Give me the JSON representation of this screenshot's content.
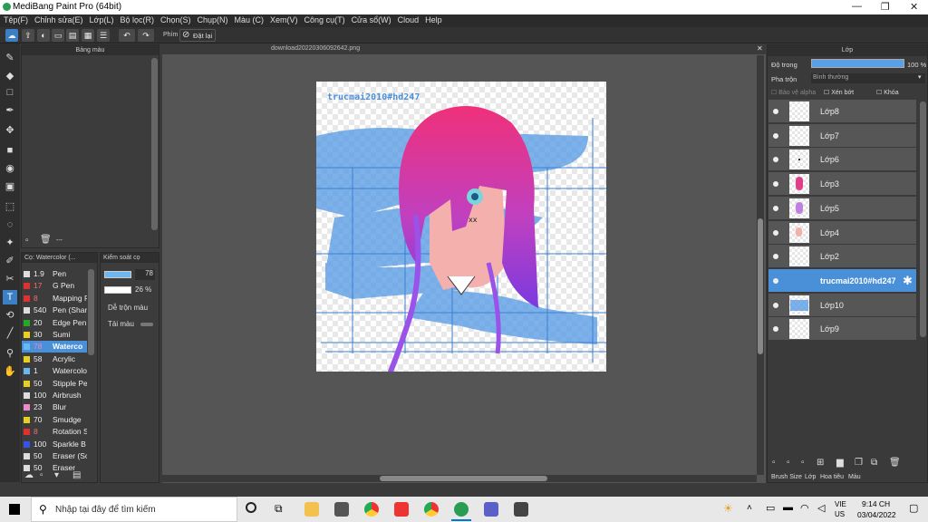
{
  "window": {
    "title": "MediBang Paint Pro (64bit)"
  },
  "menu": [
    "Tệp(F)",
    "Chỉnh sửa(E)",
    "Lớp(L)",
    "Bộ lọc(R)",
    "Chọn(S)",
    "Chụp(N)",
    "Màu (C)",
    "Xem(V)",
    "Công cụ(T)",
    "Cửa sổ(W)",
    "Cloud",
    "Help"
  ],
  "toolbar": {
    "phim_label": "Phím",
    "reset_label": "Đặt lại"
  },
  "color_panel": {
    "title": "Bảng màu",
    "ellipsis": "---"
  },
  "brush_panel": {
    "title": "Cọ: Watercolor (...",
    "items": [
      {
        "size": "1.9",
        "name": "Pen",
        "color": "#dddddd"
      },
      {
        "size": "17",
        "name": "G Pen",
        "color": "#e03030"
      },
      {
        "size": "8",
        "name": "Mapping P",
        "color": "#e03030"
      },
      {
        "size": "540",
        "name": "Pen (Shar",
        "color": "#dddddd"
      },
      {
        "size": "20",
        "name": "Edge Pen",
        "color": "#22aa22"
      },
      {
        "size": "30",
        "name": "Sumi",
        "color": "#e8d020"
      },
      {
        "size": "78",
        "name": "Waterco",
        "color": "#66b8ee",
        "selected": true
      },
      {
        "size": "58",
        "name": "Acrylic",
        "color": "#e8d020"
      },
      {
        "size": "1",
        "name": "Watercolo",
        "color": "#66b8ee"
      },
      {
        "size": "50",
        "name": "Stipple Pe",
        "color": "#e8d020"
      },
      {
        "size": "100",
        "name": "Airbrush",
        "color": "#dddddd"
      },
      {
        "size": "23",
        "name": "Blur",
        "color": "#ee88cc"
      },
      {
        "size": "70",
        "name": "Smudge",
        "color": "#e8d020"
      },
      {
        "size": "8",
        "name": "Rotation S",
        "color": "#e03030"
      },
      {
        "size": "100",
        "name": "Sparkle B",
        "color": "#3355ee"
      },
      {
        "size": "50",
        "name": "Eraser (So",
        "color": "#dddddd"
      },
      {
        "size": "50",
        "name": "Eraser",
        "color": "#dddddd"
      }
    ]
  },
  "brush_control": {
    "title": "Kiểm soát cọ",
    "size": "78",
    "opacity": "26 %",
    "mix_label": "Dễ trộn màu",
    "reload_label": "Tải màu"
  },
  "canvas": {
    "tab": "download20220306092642.png",
    "watermark": "trucmai2010#hd247"
  },
  "layer_panel": {
    "title": "Lớp",
    "opacity_label": "Độ trong",
    "opacity_value": "100 %",
    "opacity_fraction": 1.0,
    "blend_label": "Pha trộn",
    "blend_value": "Bình thường",
    "protect_alpha": "Bảo vệ alpha",
    "clip": "Xén bớt",
    "lock": "Khóa",
    "layers": [
      {
        "name": "Lớp8"
      },
      {
        "name": "Lớp7"
      },
      {
        "name": "Lớp6"
      },
      {
        "name": "Lớp3"
      },
      {
        "name": "Lớp5"
      },
      {
        "name": "Lớp4"
      },
      {
        "name": "Lớp2"
      },
      {
        "name": "trucmai2010#hd247",
        "selected": true
      },
      {
        "name": "Lớp10"
      },
      {
        "name": "Lớp9"
      }
    ],
    "tabs": [
      "Brush Size",
      "Lớp",
      "Hoa tiêu",
      "Màu"
    ]
  },
  "taskbar": {
    "search_placeholder": "Nhập tại đây để tìm kiếm",
    "lang1": "VIE",
    "lang2": "US",
    "time": "9:14 CH",
    "date": "03/04/2022"
  }
}
